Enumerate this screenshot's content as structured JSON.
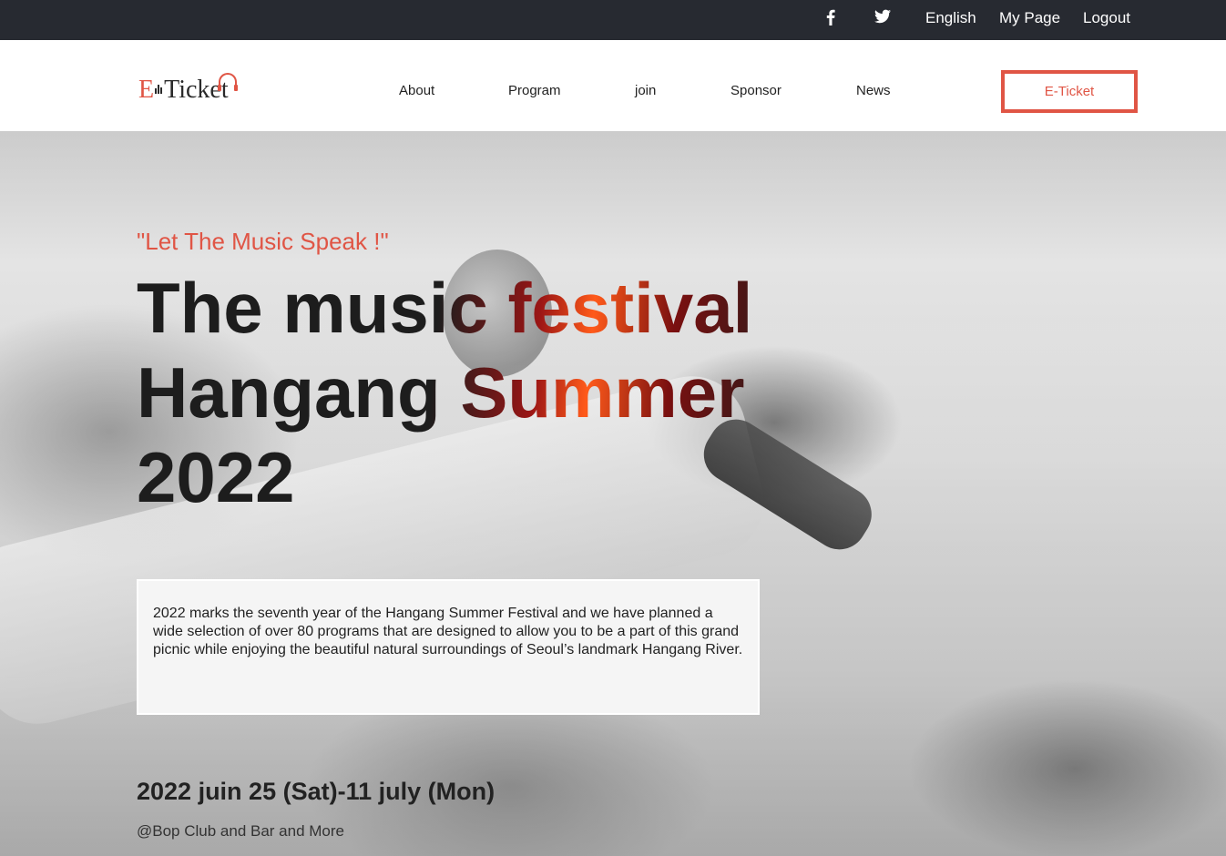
{
  "topbar": {
    "social": [
      {
        "icon": "facebook-icon",
        "glyph": "f"
      },
      {
        "icon": "twitter-icon"
      }
    ],
    "links": {
      "language": "English",
      "mypage": "My Page",
      "logout": "Logout"
    }
  },
  "header": {
    "logo_text_e": "E",
    "logo_text_rest": "Ticke",
    "logo_text_t": "t",
    "nav": {
      "about": "About",
      "program": "Program",
      "join": "join",
      "sponsor": "Sponsor",
      "news": "News"
    },
    "cta": "E-Ticket"
  },
  "hero": {
    "tagline": "\"Let The Music Speak !\"",
    "title_lines": [
      "The music festival",
      "Hangang Summer",
      "2022"
    ],
    "description": "2022 marks the seventh year of the Hangang Summer Festival and we have planned a wide selection of over 80 programs that are designed to allow you to be a part of this grand picnic while enjoying the beautiful natural surroundings of Seoul’s landmark Hangang River.",
    "date": "2022 juin 25 (Sat)-11 july (Mon)",
    "venue": "@Bop Club and Bar and More"
  },
  "colors": {
    "topbar_bg": "#272a31",
    "accent": "#e05545",
    "title_gradient_mid": "#ff5a1a"
  }
}
